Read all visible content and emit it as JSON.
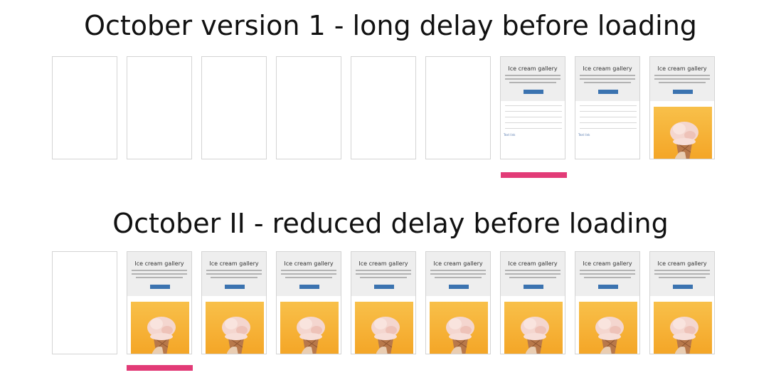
{
  "rows": [
    {
      "title": "October version 1 - long delay before loading",
      "frames": [
        "blank",
        "blank",
        "blank",
        "blank",
        "blank",
        "blank",
        "text",
        "text",
        "image"
      ],
      "marker_frame": 6
    },
    {
      "title": "October II - reduced delay before loading",
      "frames": [
        "blank",
        "image",
        "image",
        "image",
        "image",
        "image",
        "image",
        "image",
        "image"
      ],
      "marker_frame": 1
    }
  ],
  "frame_content": {
    "title": "Ice cream gallery",
    "footer_link": "Text link",
    "photo_subject": "ice-cream-cone",
    "hero_color": "#eeeeee",
    "button_color": "#3b73b0",
    "photo_color": "#f6b233"
  },
  "marker_color": "#e23b77"
}
